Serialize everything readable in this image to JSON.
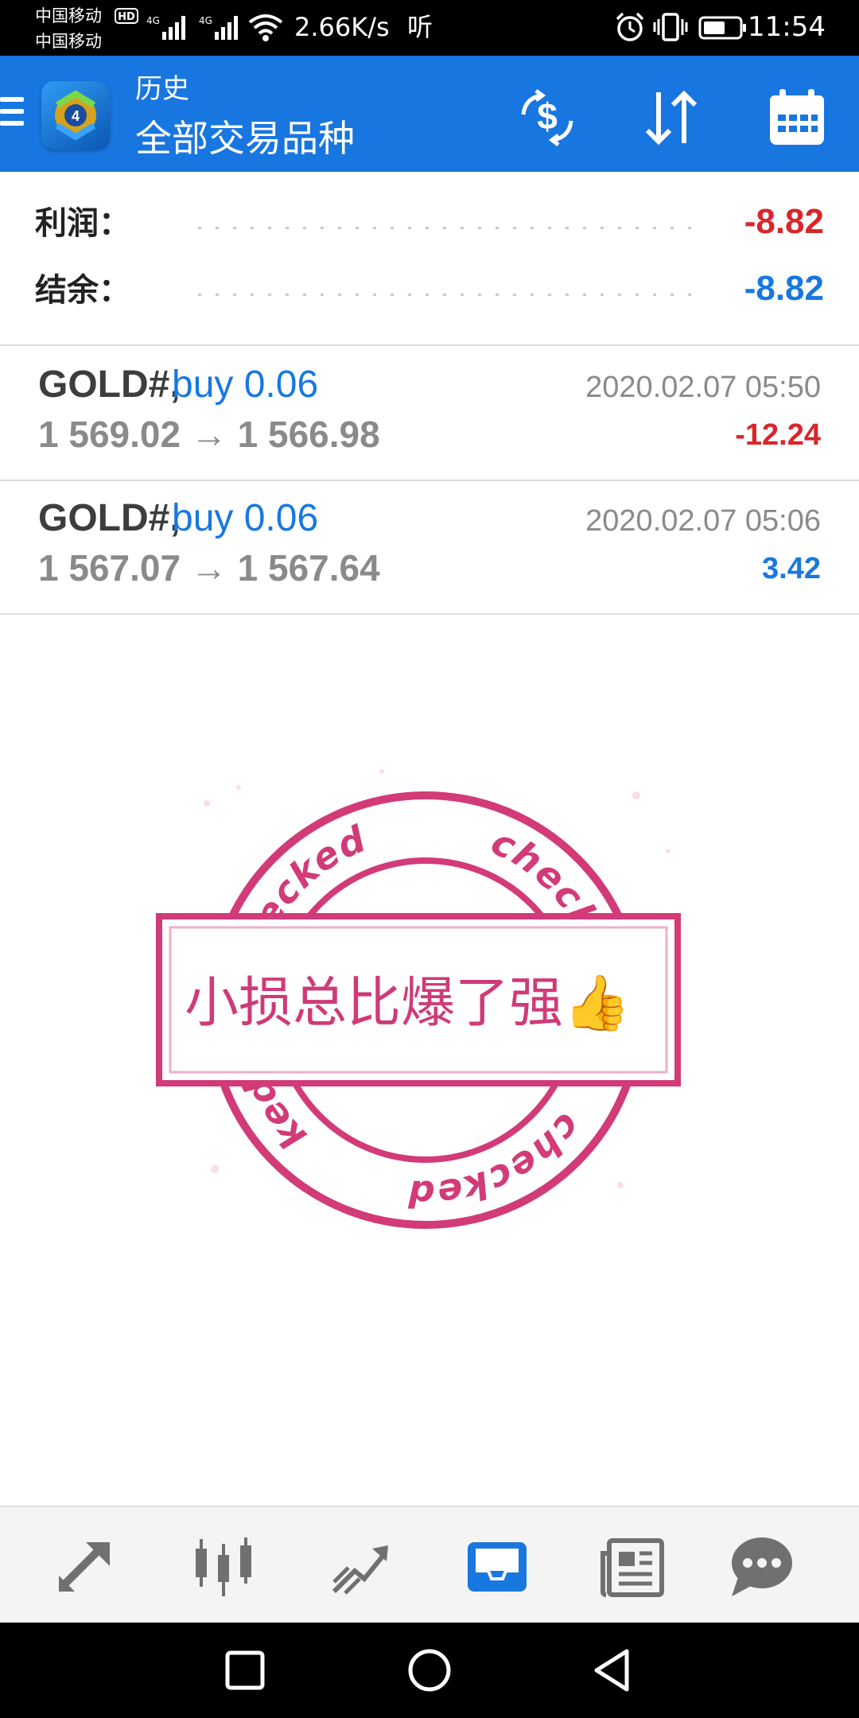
{
  "status_bar": {
    "carrier_1": "中国移动",
    "carrier_2": "中国移动",
    "hd_badge": "HD",
    "net_1": "4G",
    "net_2": "4G",
    "net_speed": "2.66K/s",
    "listen_label": "听",
    "time": "11:54"
  },
  "app_bar": {
    "title": "历史",
    "subtitle": "全部交易品种",
    "actions": [
      "deposit-icon",
      "sort-icon",
      "calendar-icon"
    ]
  },
  "summary": {
    "profit_label": "利润：",
    "profit_value": "-8.82",
    "balance_label": "结余：",
    "balance_value": "-8.82",
    "colors": {
      "negative": "#d9262b",
      "positive": "#1878e0"
    }
  },
  "trades": [
    {
      "symbol": "GOLD#,",
      "direction": "buy 0.06",
      "prices": "1 569.02 → 1 566.98",
      "time": "2020.02.07 05:50",
      "profit": "-12.24"
    },
    {
      "symbol": "GOLD#,",
      "direction": "buy 0.06",
      "prices": "1 567.07 → 1 567.64",
      "time": "2020.02.07 05:06",
      "profit": "3.42"
    }
  ],
  "stamp": {
    "ring_text": "checked",
    "center_text": "小损总比爆了强",
    "emoji": "👍",
    "color": "#cf3a78"
  },
  "bottom_nav": {
    "items": [
      "quotes-icon",
      "chart-icon",
      "trade-icon",
      "history-icon",
      "news-icon",
      "chat-icon"
    ],
    "active": "history-icon",
    "active_color": "#1878e0"
  },
  "system_nav": [
    "recent-apps-icon",
    "home-icon",
    "back-icon"
  ]
}
